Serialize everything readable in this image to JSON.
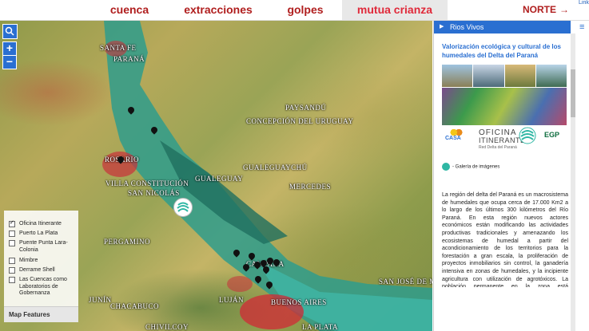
{
  "nav": {
    "tabs": [
      {
        "label": "cuenca",
        "active": false
      },
      {
        "label": "extracciones",
        "active": false
      },
      {
        "label": "golpes",
        "active": false
      },
      {
        "label": "mutua crianza",
        "active": true
      }
    ],
    "north_label": "NORTE",
    "link_label": "Link"
  },
  "map": {
    "zoom_in": "+",
    "zoom_out": "−",
    "labels": [
      "SANTA FE",
      "PARANÁ",
      "PAYSANDÚ",
      "CONCEPCIÓN DEL URUGUAY",
      "ROSARIO",
      "VILLA CONSTITUCIÓN",
      "SAN NICOLÁS",
      "GUALEGUAY",
      "GUALEGUAYCHÚ",
      "MERCEDES",
      "PERGAMINO",
      "CAMPANA",
      "SAN JOSÉ DE MAYO",
      "JUNÍN",
      "LUJÁN",
      "BUENOS AIRES",
      "CHACABUCO",
      "CHIVILCOY",
      "LA PLATA"
    ]
  },
  "legend": {
    "items": [
      {
        "label": "Oficina Itinerante",
        "checked": true
      },
      {
        "label": "Puerto La Plata",
        "checked": false
      },
      {
        "label": "Puente Punta Lara-Colonia",
        "checked": false
      },
      {
        "label": "Mimbre",
        "checked": false
      },
      {
        "label": "Derrame Shell",
        "checked": false
      },
      {
        "label": "Las Cuencas como Laboratorios de Gobernanza",
        "checked": false
      }
    ],
    "footer": "Map Features"
  },
  "panel": {
    "header": "Rios Vivos",
    "title": "Valorización ecológica y cultural de los humedales del Delta del Paraná",
    "logos": {
      "casa": "CASA",
      "oficina_line1": "OFICINA",
      "oficina_line2": "ITINERANTE",
      "oficina_sub": "Red Delta del Paraná",
      "egp": "EGP"
    },
    "gallery_label": "- Galería de imágenes",
    "body": "La región del delta del Paraná es un macrosistema de humedales que ocupa cerca de 17.000 Km2 a lo largo de los últimos 300 kilómetros del Río Paraná. En esta región nuevos actores económicos están modificando las actividades productivas tradicionales y amenazando los ecosistemas de humedal a partir del acondicionamiento de los territorios para la forestación a gran escala, la proliferación de proyectos inmobiliarios sin control, la ganadería intensiva en zonas de humedales, y la incipiente agricultura con utilización de agrotóxicos. La población permanente en la zona está disminuyendo por falta o degradación de servicios"
  },
  "colors": {
    "accent": "#2a6fd1",
    "nav_text": "#b01e1e",
    "river": "#2f9c8c"
  }
}
